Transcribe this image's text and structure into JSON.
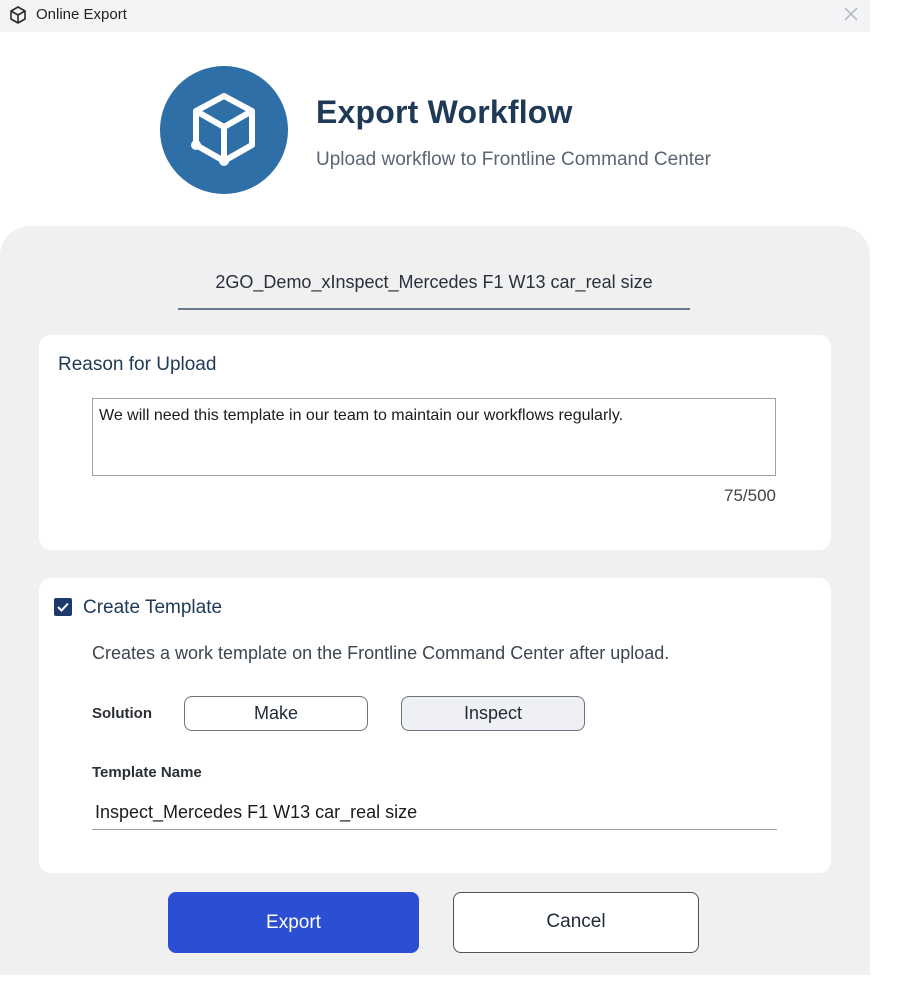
{
  "window": {
    "title": "Online Export",
    "app_icon": "cube-icon",
    "close_icon": "close-icon"
  },
  "header": {
    "logo_icon": "cube-icon",
    "logo_color": "#2f6fa8",
    "title": "Export Workflow",
    "subtitle": "Upload workflow to Frontline Command Center"
  },
  "workflow": {
    "name": "2GO_Demo_xInspect_Mercedes F1 W13 car_real size"
  },
  "reason": {
    "label": "Reason for Upload",
    "value": "We will need this template in our team to maintain our workflows regularly.",
    "counter": "75/500"
  },
  "template": {
    "checkbox_checked": true,
    "checkbox_label": "Create Template",
    "description": "Creates a work template on the Frontline Command Center after upload.",
    "solution_label": "Solution",
    "solution_options": [
      "Make",
      "Inspect"
    ],
    "solution_selected": "Inspect",
    "name_label": "Template Name",
    "name_value": "Inspect_Mercedes F1 W13 car_real size"
  },
  "actions": {
    "export_label": "Export",
    "cancel_label": "Cancel",
    "accent_color": "#2b4ed3"
  }
}
